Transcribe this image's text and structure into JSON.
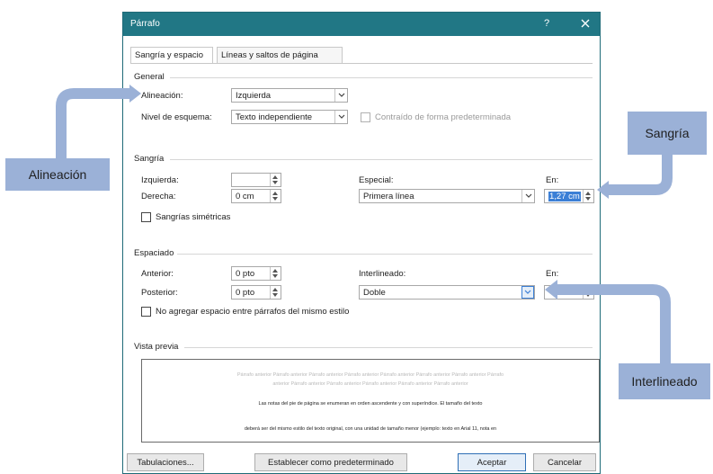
{
  "dialog": {
    "title": "Párrafo",
    "help_label": "?",
    "tabs": [
      {
        "label": "Sangría y espacio",
        "active": true
      },
      {
        "label": "Líneas y saltos de página",
        "active": false
      }
    ]
  },
  "general": {
    "section_label": "General",
    "alignment_label": "Alineación:",
    "alignment_value": "Izquierda",
    "outline_label": "Nivel de esquema:",
    "outline_value": "Texto independiente",
    "collapsed_label": "Contraído de forma predeterminada"
  },
  "indent": {
    "section_label": "Sangría",
    "left_label": "Izquierda:",
    "left_value": "",
    "right_label": "Derecha:",
    "right_value": "0 cm",
    "special_label": "Especial:",
    "special_value": "Primera línea",
    "by_label": "En:",
    "by_value": "1,27 cm",
    "mirror_label": "Sangrías simétricas"
  },
  "spacing": {
    "section_label": "Espaciado",
    "before_label": "Anterior:",
    "before_value": "0 pto",
    "after_label": "Posterior:",
    "after_value": "0 pto",
    "line_label": "Interlineado:",
    "line_value": "Doble",
    "at_label": "En:",
    "at_value": "",
    "no_space_label": "No agregar espacio entre párrafos del mismo estilo"
  },
  "preview": {
    "section_label": "Vista previa",
    "line1": "Párrafo anterior Párrafo anterior Párrafo anterior Párrafo anterior Párrafo anterior Párrafo anterior Párrafo anterior Párrafo",
    "line2": "anterior Párrafo anterior Párrafo anterior Párrafo anterior Párrafo anterior Párrafo anterior",
    "line3": "Las notas del pie de página se enumeran en orden ascendente y con superíndice. El tamaño del texto",
    "line4": "deberá ser del mismo estilo del texto original, con una unidad de tamaño menor (ejemplo: texto en Arial 11, nota en"
  },
  "buttons": {
    "tabs_label": "Tabulaciones...",
    "default_label": "Establecer como predeterminado",
    "ok_label": "Aceptar",
    "cancel_label": "Cancelar"
  },
  "callouts": {
    "alignment": "Alineación",
    "indent": "Sangría",
    "line_spacing": "Interlineado"
  },
  "colors": {
    "titlebar": "#217785",
    "callout": "#9bb1d7",
    "highlight": "#3b7fd6"
  }
}
